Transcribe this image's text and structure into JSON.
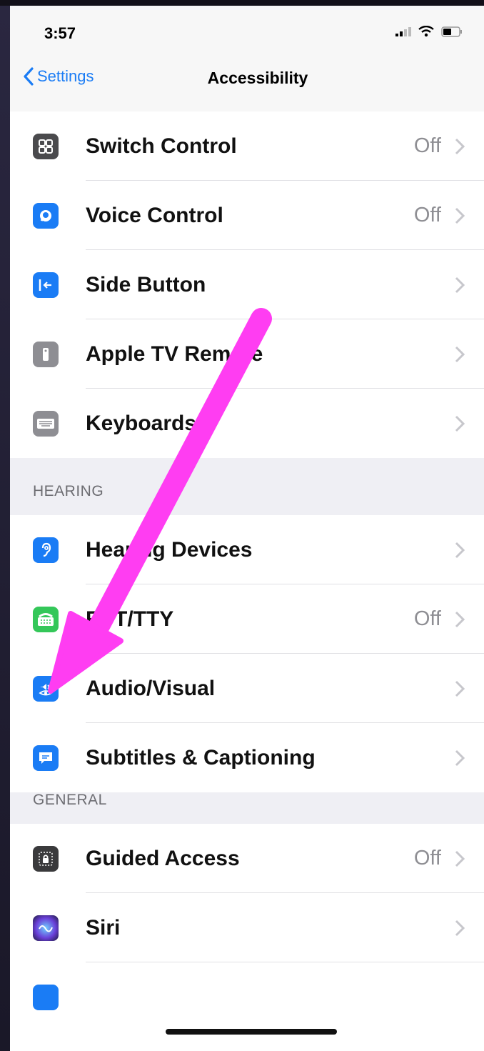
{
  "status": {
    "time": "3:57"
  },
  "nav": {
    "back_label": "Settings",
    "title": "Accessibility"
  },
  "group1": [
    {
      "label": "Switch Control",
      "value": "Off",
      "icon": "switch-control-icon",
      "color": "#4a4a4d"
    },
    {
      "label": "Voice Control",
      "value": "Off",
      "icon": "voice-control-icon",
      "color": "#1a7cf5"
    },
    {
      "label": "Side Button",
      "value": "",
      "icon": "side-button-icon",
      "color": "#1a7cf5"
    },
    {
      "label": "Apple TV Remote",
      "value": "",
      "icon": "apple-tv-remote-icon",
      "color": "#8e8e93"
    },
    {
      "label": "Keyboards",
      "value": "",
      "icon": "keyboard-icon",
      "color": "#8e8e93"
    }
  ],
  "hearing": {
    "header": "HEARING",
    "items": [
      {
        "label": "Hearing Devices",
        "value": "",
        "icon": "ear-icon",
        "color": "#1a7cf5"
      },
      {
        "label": "RTT/TTY",
        "value": "Off",
        "icon": "tty-icon",
        "color": "#34c759"
      },
      {
        "label": "Audio/Visual",
        "value": "",
        "icon": "audio-visual-icon",
        "color": "#1a7cf5"
      },
      {
        "label": "Subtitles & Captioning",
        "value": "",
        "icon": "captions-icon",
        "color": "#1a7cf5"
      }
    ]
  },
  "general": {
    "header": "GENERAL",
    "items": [
      {
        "label": "Guided Access",
        "value": "Off",
        "icon": "guided-access-icon",
        "color": "#3a3a3c"
      },
      {
        "label": "Siri",
        "value": "",
        "icon": "siri-icon",
        "color": "#2c2c54"
      }
    ]
  },
  "annotation": {
    "arrow_color": "#ff3df2"
  }
}
